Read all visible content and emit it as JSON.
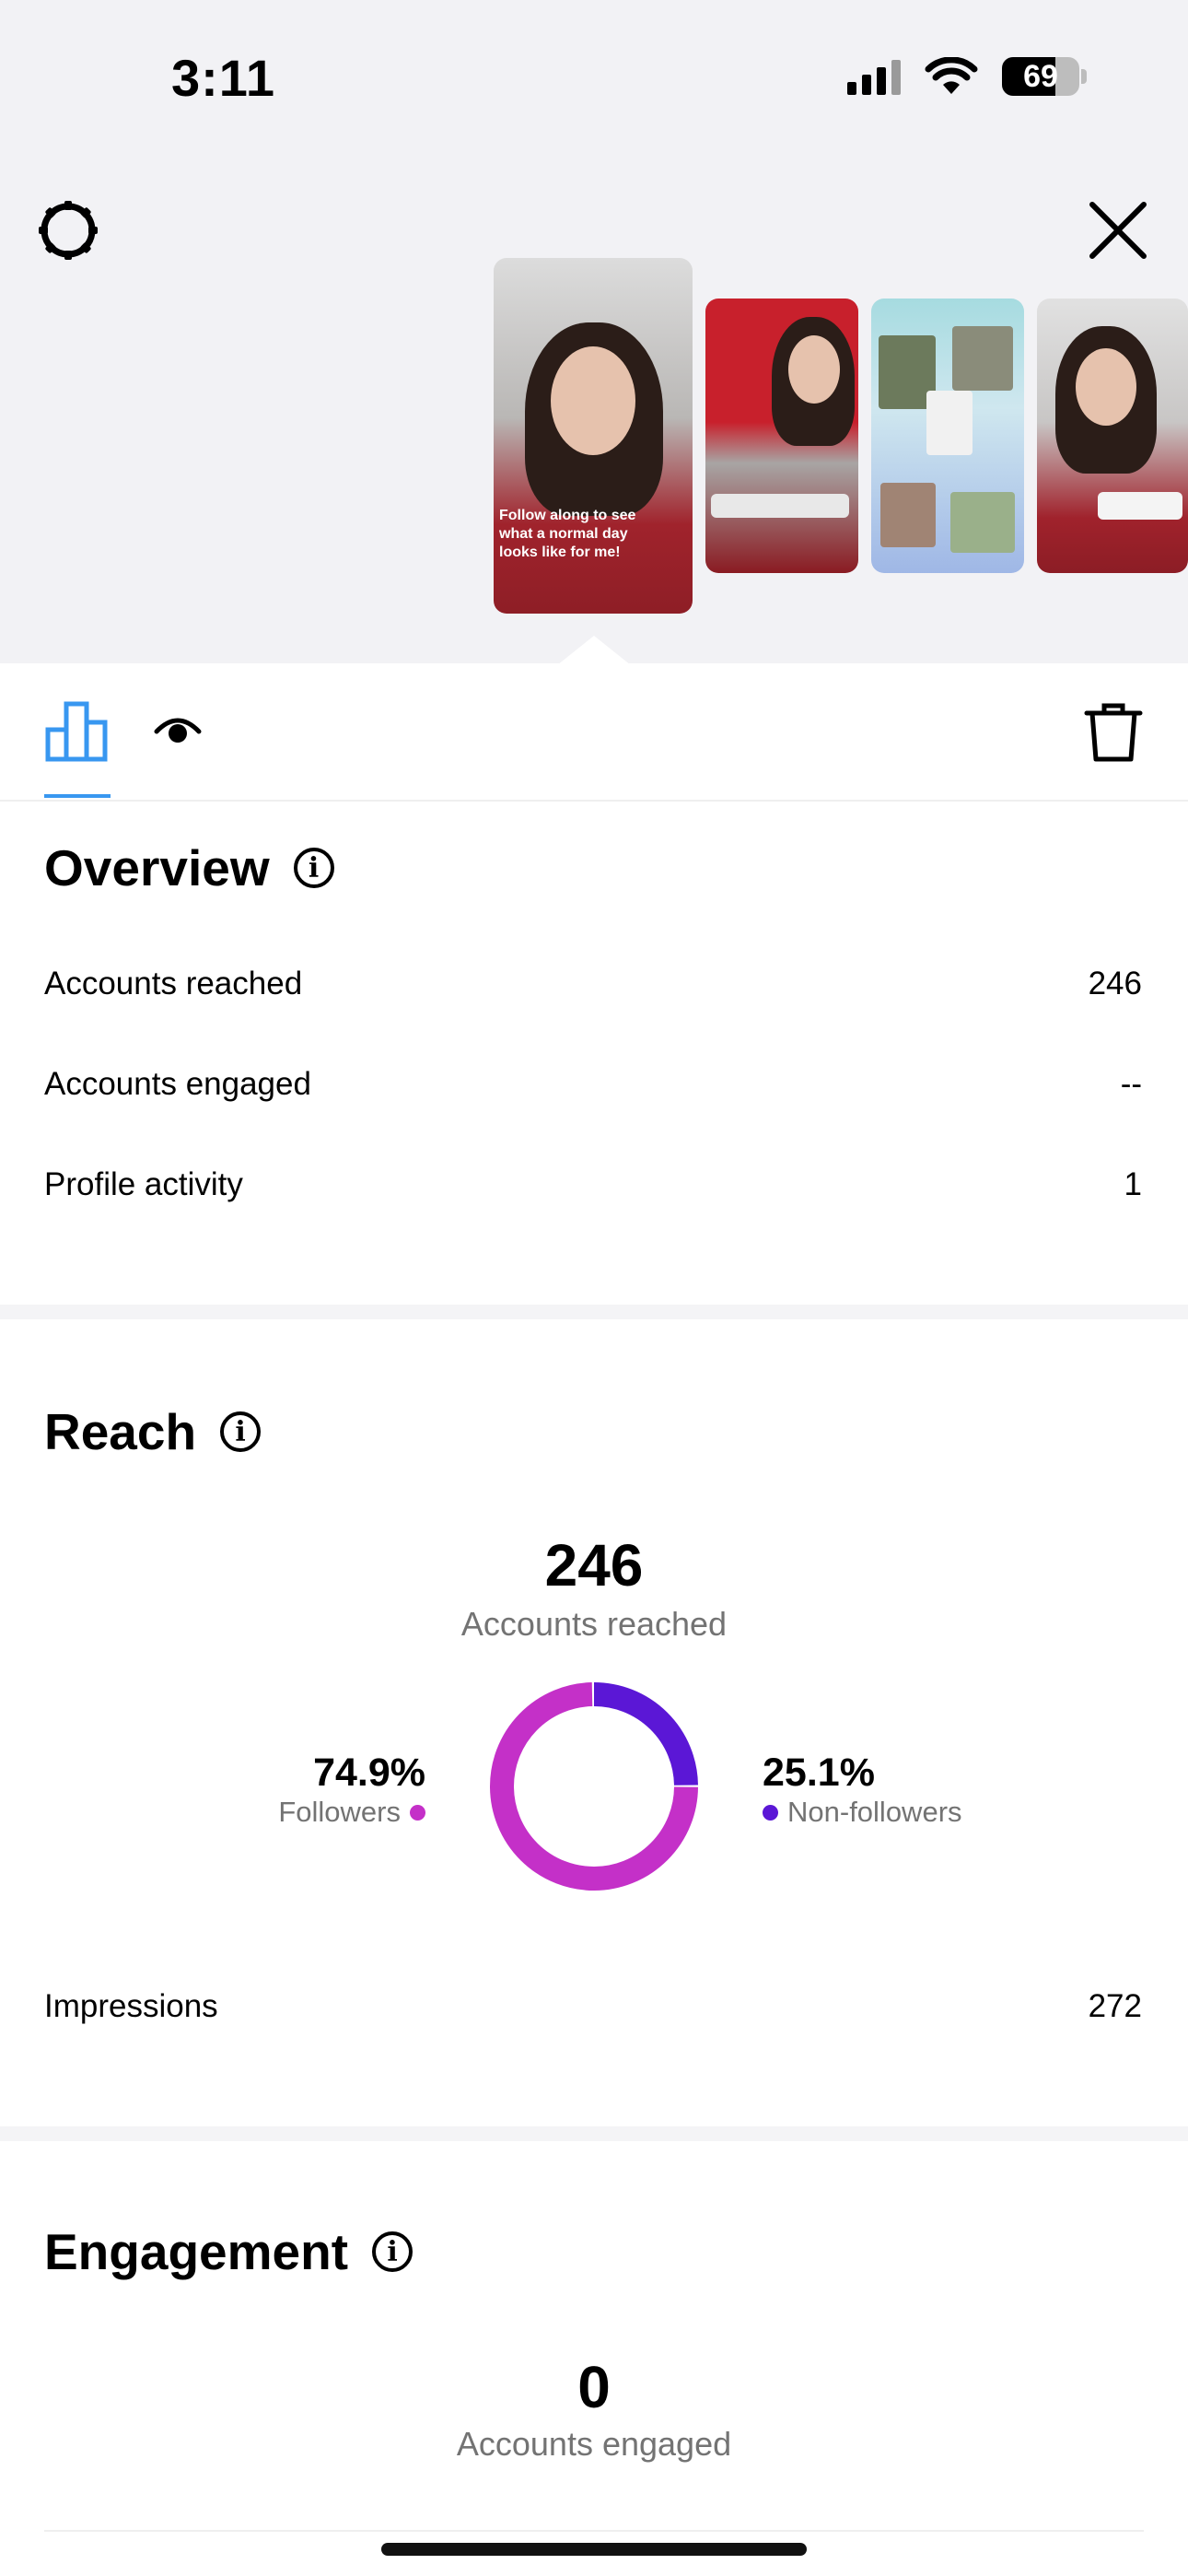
{
  "status_bar": {
    "time": "3:11",
    "battery": "69",
    "battery_level": 0.69
  },
  "header": {
    "settings_icon": "gear-icon",
    "close_icon": "close-icon"
  },
  "stories": [
    {
      "caption": "Follow along to see what a normal day looks like for me!",
      "selected": true
    },
    {
      "caption": ""
    },
    {
      "caption": ""
    },
    {
      "caption": ""
    }
  ],
  "tabs": [
    {
      "name": "insights",
      "icon": "bar-chart-icon",
      "active": true
    },
    {
      "name": "viewers",
      "icon": "eye-icon",
      "active": false
    }
  ],
  "actions": {
    "delete_icon": "trash-icon"
  },
  "overview": {
    "title": "Overview",
    "rows": [
      {
        "label": "Accounts reached",
        "value": "246"
      },
      {
        "label": "Accounts engaged",
        "value": "--"
      },
      {
        "label": "Profile activity",
        "value": "1"
      }
    ]
  },
  "reach": {
    "title": "Reach",
    "total": "246",
    "total_label": "Accounts reached",
    "followers_pct": "74.9%",
    "followers_label": "Followers",
    "nonfollowers_pct": "25.1%",
    "nonfollowers_label": "Non-followers",
    "impressions_label": "Impressions",
    "impressions_value": "272",
    "colors": {
      "followers": "#c430c8",
      "non_followers": "#5b17d6"
    }
  },
  "chart_data": {
    "type": "pie",
    "categories": [
      "Followers",
      "Non-followers"
    ],
    "values": [
      74.9,
      25.1
    ],
    "colors": [
      "#c430c8",
      "#5b17d6"
    ]
  },
  "engagement": {
    "title": "Engagement",
    "total": "0",
    "total_label": "Accounts engaged"
  }
}
